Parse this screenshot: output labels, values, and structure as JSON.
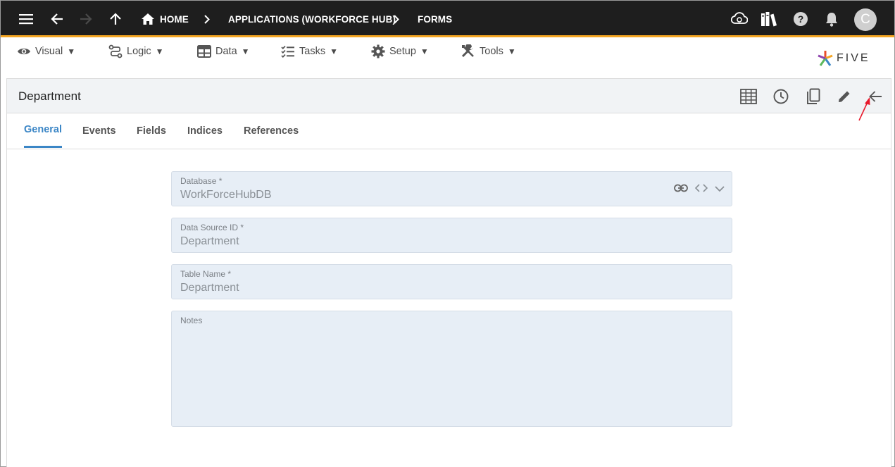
{
  "topbar": {
    "breadcrumbs": [
      "HOME",
      "APPLICATIONS (WORKFORCE HUB)",
      "FORMS"
    ],
    "avatar_initial": "C",
    "accent_color": "#f5a623",
    "icons": [
      "menu-icon",
      "back-icon",
      "forward-icon",
      "up-icon",
      "home-icon",
      "chevron-right-icon",
      "cloud-icon",
      "books-icon",
      "help-icon",
      "bell-icon"
    ]
  },
  "menubar": {
    "items": [
      "Visual",
      "Logic",
      "Data",
      "Tasks",
      "Setup",
      "Tools"
    ],
    "dropdown_glyph": "▼",
    "logo_text": "FIVE"
  },
  "panel": {
    "title": "Department",
    "header_icons": [
      "grid-icon",
      "history-icon",
      "copy-icon",
      "edit-icon",
      "back-arrow-icon"
    ],
    "tabs": [
      "General",
      "Events",
      "Fields",
      "Indices",
      "References"
    ],
    "active_tab": "General",
    "active_color": "#3b86c6"
  },
  "form": {
    "database": {
      "label": "Database *",
      "value": "WorkForceHubDB"
    },
    "data_source_id": {
      "label": "Data Source ID *",
      "value": "Department"
    },
    "table_name": {
      "label": "Table Name *",
      "value": "Department"
    },
    "notes": {
      "label": "Notes",
      "value": ""
    }
  }
}
